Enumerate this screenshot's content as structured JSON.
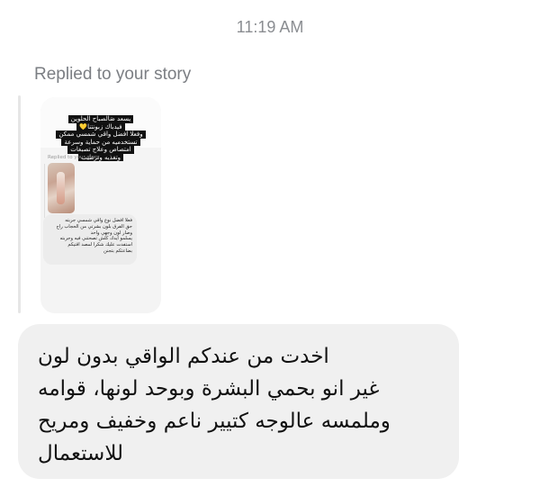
{
  "timestamp": "11:19 AM",
  "replied_label": "Replied to your story",
  "story": {
    "caption_lines": [
      "يسعد صَالصباح الحلوين",
      "فيدباك زبونتنا💛",
      "وفعلا افضل واقي شمسي ممكن",
      "تستخدميه من حماية وسرعة",
      "امتصاص وعلاج تصبغات",
      "وتغذيه وترطيب"
    ],
    "inner_replied_label": "Replied to your story",
    "inner_message_lines": [
      "فعلا افضل نوع واقي شمسي جربته",
      "حق الفرق بلون بشرتي من الحجاب راح",
      "وصار لون وجهي واحد",
      "يسلمو ايدك كلش تصحتني فيه وجربته",
      "استفدت عليك شكرا لمصد اقتيكم",
      "بضاعتكم بتجنن"
    ]
  },
  "message": {
    "lines": [
      "اخدت من عندكم الواقي بدون لون",
      "غير انو بحمي البشرة وبوحد لونها، قوامه",
      "وملمسه عالوجه كتيير ناعم وخفيف ومريح",
      "للاستعمال"
    ]
  }
}
